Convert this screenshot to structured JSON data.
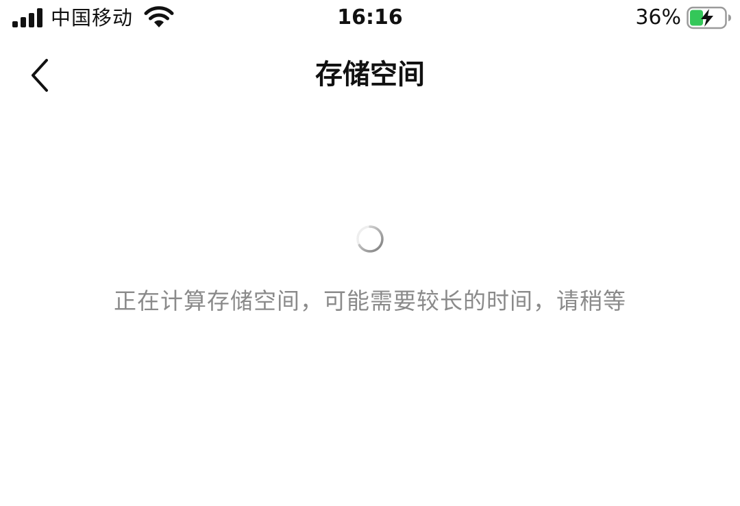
{
  "status_bar": {
    "carrier": "中国移动",
    "time": "16:16",
    "battery_percent": "36%",
    "icons": {
      "signal": "signal-bars-icon",
      "wifi": "wifi-icon",
      "battery": "battery-charging-icon"
    },
    "battery_fill_color": "#34c759"
  },
  "nav": {
    "title": "存储空间",
    "back_icon": "chevron-left-icon"
  },
  "content": {
    "loading_icon": "spinner-icon",
    "loading_message": "正在计算存储空间，可能需要较长的时间，请稍等"
  }
}
